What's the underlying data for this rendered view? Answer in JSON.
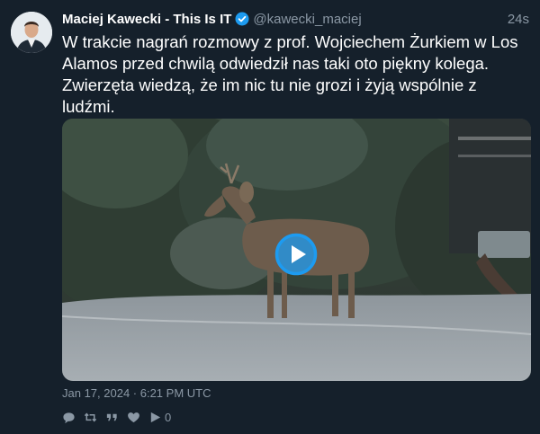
{
  "author": {
    "name": "Maciej Kawecki - This Is IT",
    "handle": "@kawecki_maciej",
    "time_ago": "24s",
    "verified": true
  },
  "tweet": {
    "text": "W trakcie nagrań rozmowy z prof. Wojciechem Żurkiem w Los Alamos przed chwilą odwiedził nas taki oto piękny kolega. Zwierzęta wiedzą, że im nic tu nie grozi i żyją wspólnie z ludźmi.",
    "timestamp": "Jan 17, 2024 · 6:21 PM UTC"
  },
  "media": {
    "type": "video",
    "play_icon": "play-icon",
    "accent_color": "#1d9bf0"
  },
  "actions": {
    "reply_icon": "reply-icon",
    "retweet_icon": "retweet-icon",
    "quote_icon": "quote-icon",
    "like_icon": "heart-icon",
    "views_icon": "play-count-icon",
    "views_count": "0"
  },
  "colors": {
    "background": "#15202b",
    "secondary_text": "#8b98a5",
    "verified": "#1d9bf0"
  }
}
